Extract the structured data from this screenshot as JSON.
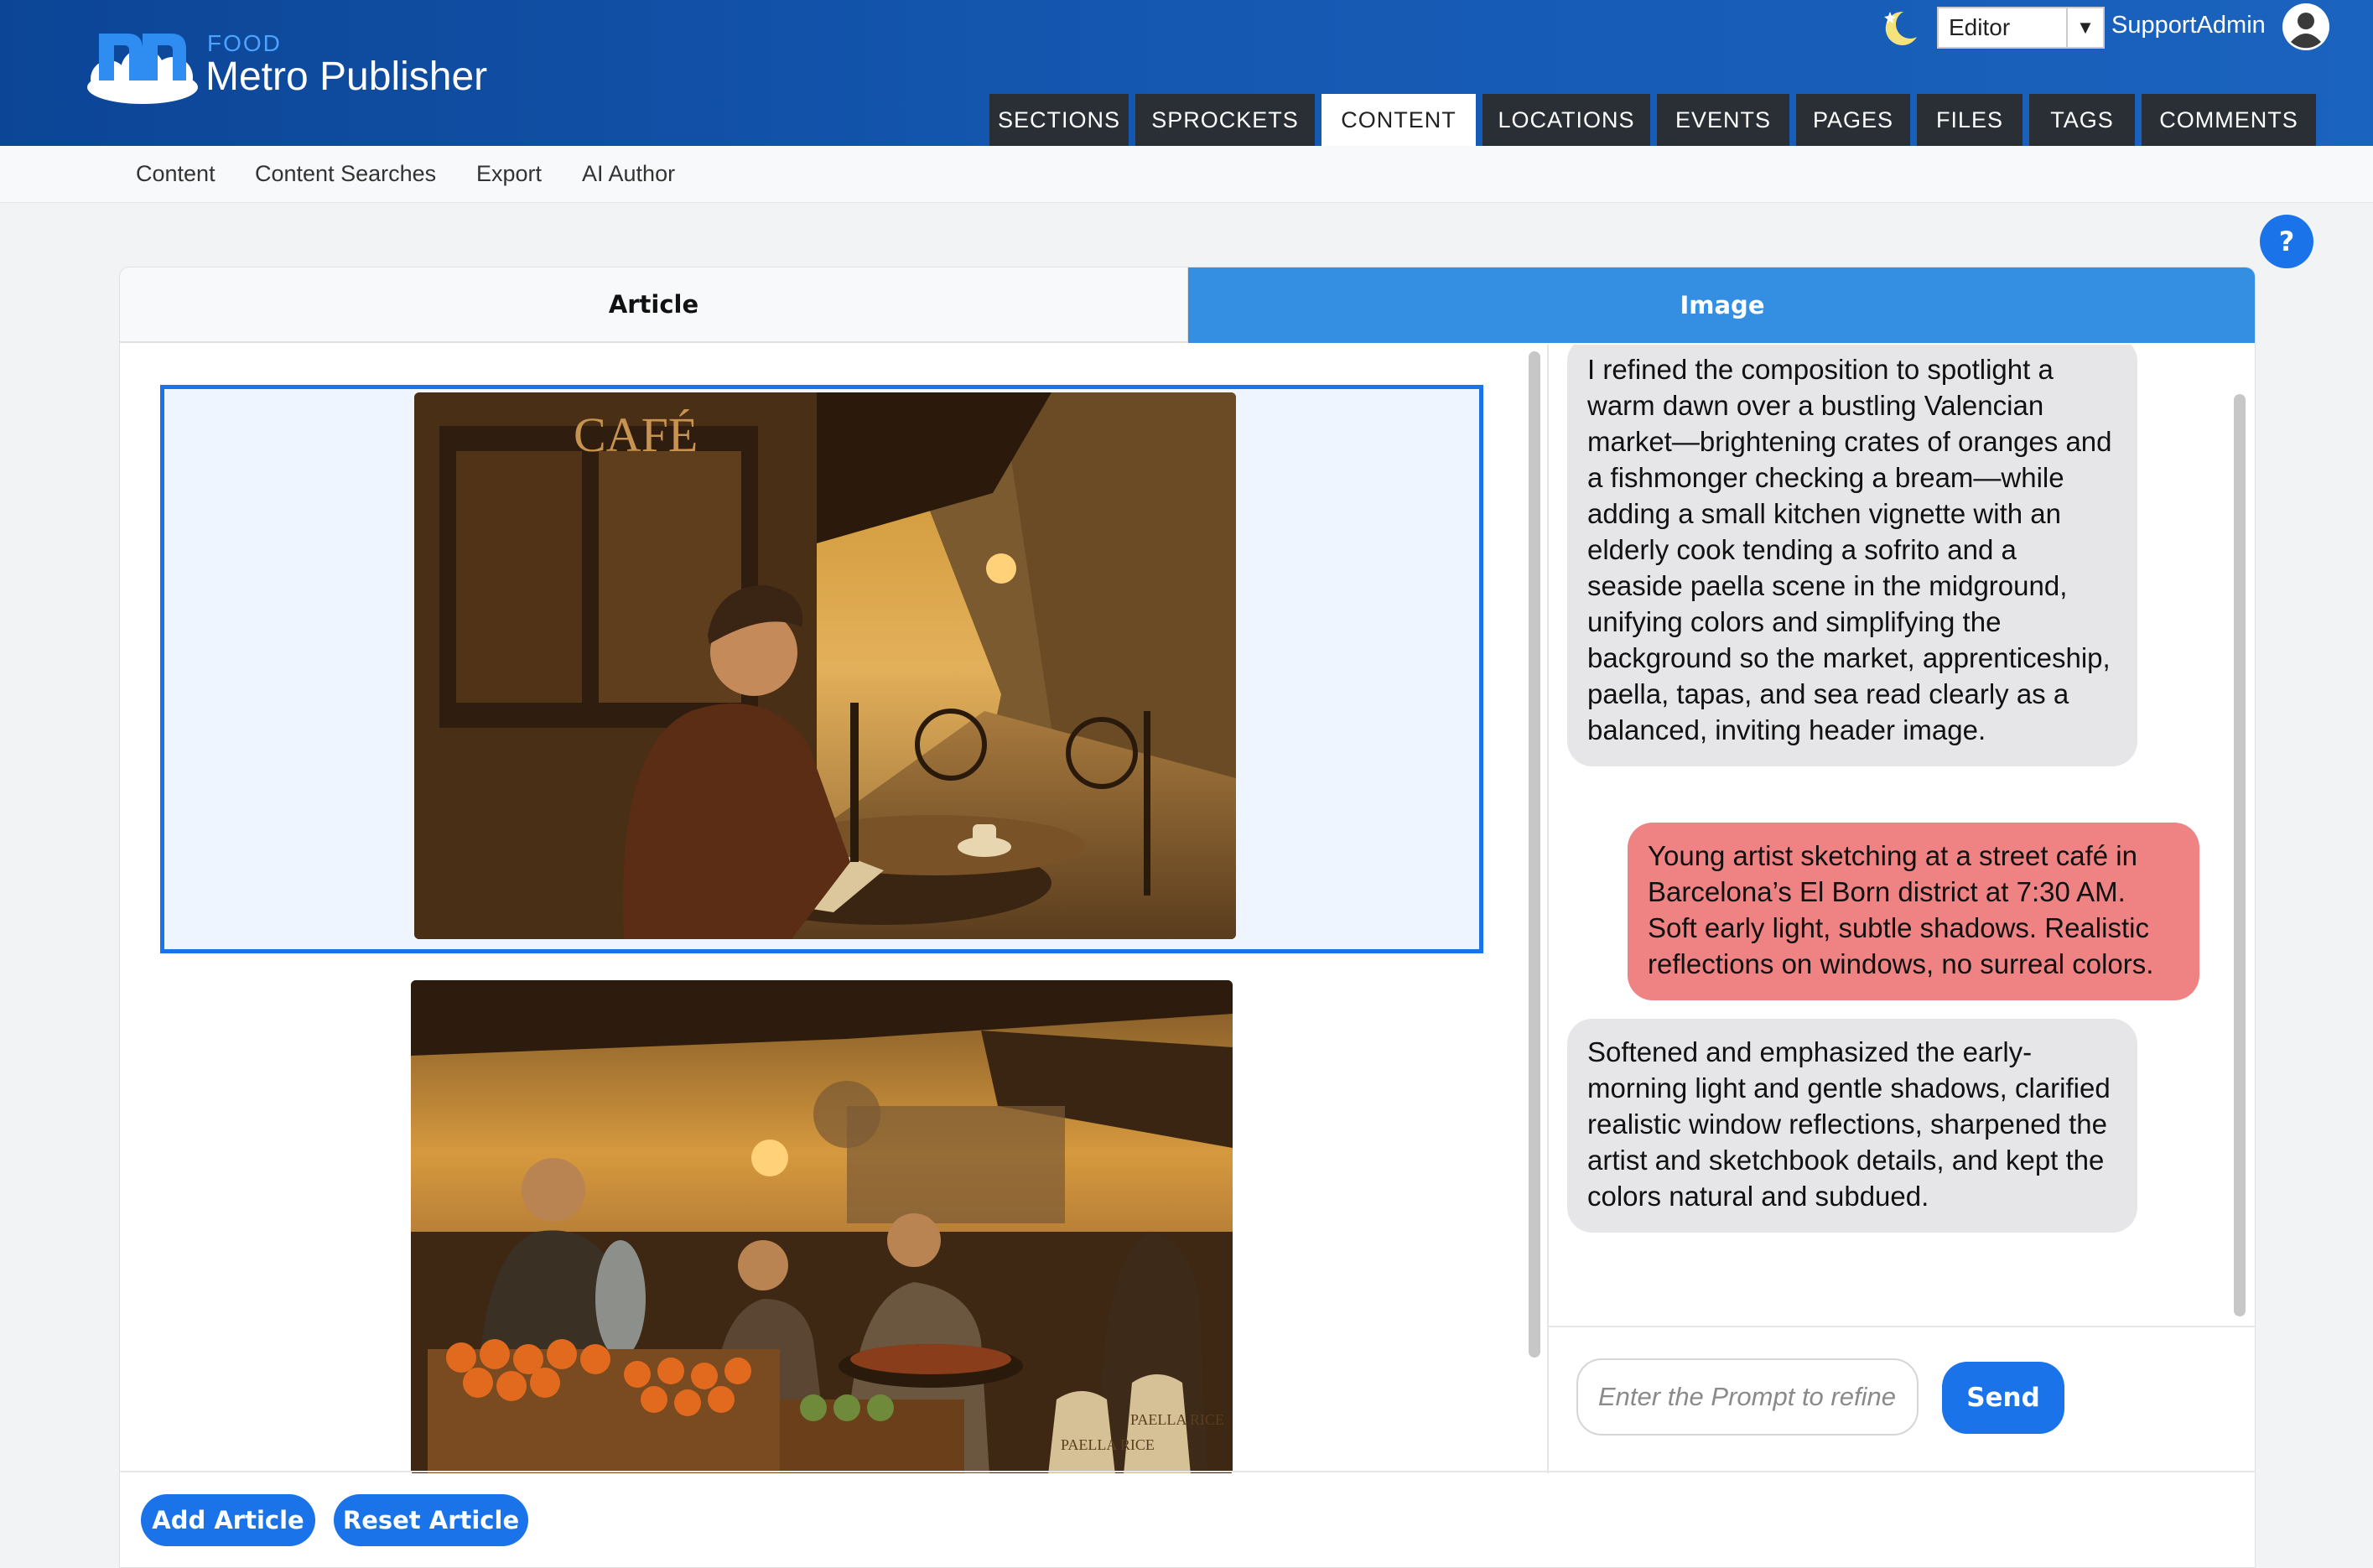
{
  "brand": {
    "kicker": "FOOD",
    "name": "Metro Publisher"
  },
  "header": {
    "role_selected": "Editor",
    "user": "SupportAdmin",
    "nav_tabs": [
      {
        "label": "SECTIONS",
        "active": false
      },
      {
        "label": "SPROCKETS",
        "active": false
      },
      {
        "label": "CONTENT",
        "active": true
      },
      {
        "label": "LOCATIONS",
        "active": false
      },
      {
        "label": "EVENTS",
        "active": false
      },
      {
        "label": "PAGES",
        "active": false
      },
      {
        "label": "FILES",
        "active": false
      },
      {
        "label": "TAGS",
        "active": false
      },
      {
        "label": "COMMENTS",
        "active": false
      }
    ]
  },
  "subnav": [
    "Content",
    "Content Searches",
    "Export",
    "AI Author"
  ],
  "help_label": "?",
  "tabs": {
    "article": "Article",
    "image": "Image"
  },
  "chat": {
    "messages": [
      {
        "role": "assistant",
        "text": "I refined the composition to spotlight a warm dawn over a bustling Valencian market—brightening crates of oranges and a fishmonger checking a bream—while adding a small kitchen vignette with an elderly cook tending a sofrito and a seaside paella scene in the midground, unifying colors and simplifying the background so the market, apprenticeship, paella, tapas, and sea read clearly as a balanced, inviting header image."
      },
      {
        "role": "user",
        "text": "Young artist sketching at a street café in Barcelona’s El Born district at 7:30 AM. Soft early light, subtle shadows. Realistic reflections on windows, no surreal colors."
      },
      {
        "role": "assistant",
        "text": "Softened and emphasized the early-morning light and gentle shadows, clarified realistic window reflections, sharpened the artist and sketchbook details, and kept the colors natural and subdued."
      }
    ],
    "prompt_placeholder": "Enter the Prompt to refine",
    "send_label": "Send"
  },
  "images": [
    {
      "name": "cafe-artist-image",
      "selected": true,
      "sign_text": "CAFÉ"
    },
    {
      "name": "market-scene-image",
      "selected": false,
      "sack_labels": [
        "PAELLA RICE",
        "PAELLA RICE"
      ]
    }
  ],
  "footer": {
    "add_article": "Add Article",
    "reset_article": "Reset Article"
  },
  "colors": {
    "header_blue": "#1558b2",
    "accent_blue": "#1a73e8",
    "tab_active_blue": "#348fe2",
    "user_bubble": "#ef8383",
    "ai_bubble": "#e6e6e9"
  }
}
